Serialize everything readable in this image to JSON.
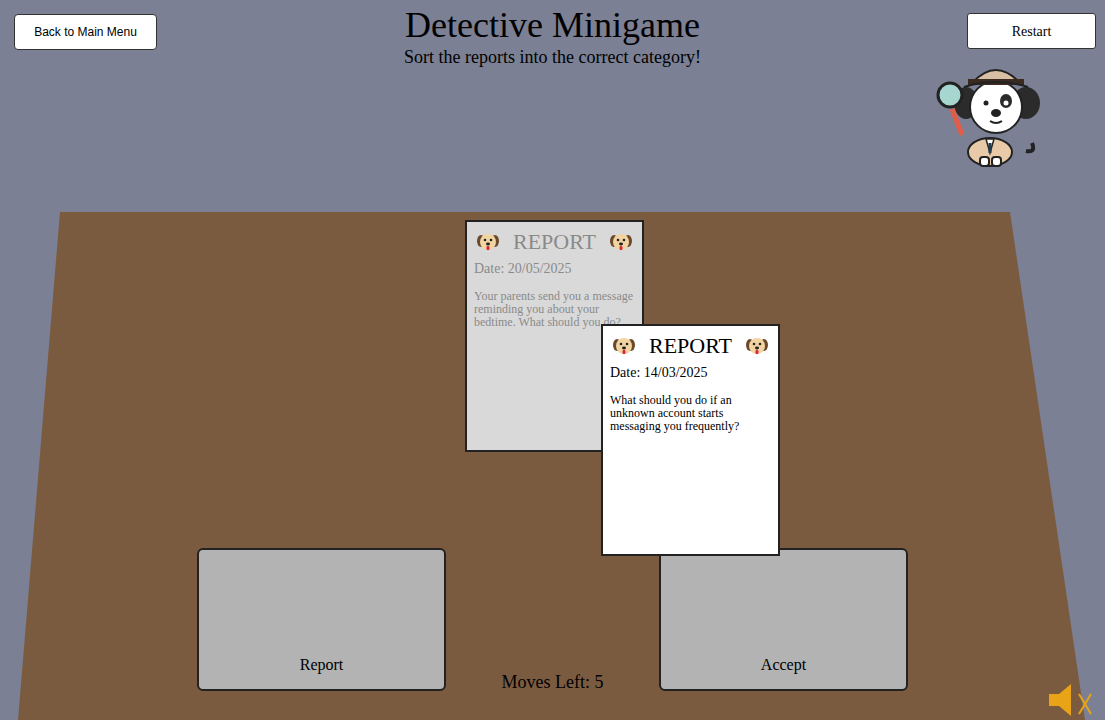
{
  "nav": {
    "back_button": "Back to Main Menu",
    "restart_button": "Restart"
  },
  "title": "Detective Minigame",
  "subtitle": "Sort the reports into the correct category!",
  "cards": [
    {
      "heading": "REPORT",
      "date": "Date: 20/05/2025",
      "text": "Your parents send you a message reminding you about your bedtime. What should you do?",
      "active": false
    },
    {
      "heading": "REPORT",
      "date": "Date: 14/03/2025",
      "text": "What should you do if an unknown account starts messaging you frequently?",
      "active": true
    }
  ],
  "bins": [
    {
      "label": "Report"
    },
    {
      "label": "Accept"
    }
  ],
  "moves": "Moves Left: 5",
  "sound": {
    "muted": true
  }
}
